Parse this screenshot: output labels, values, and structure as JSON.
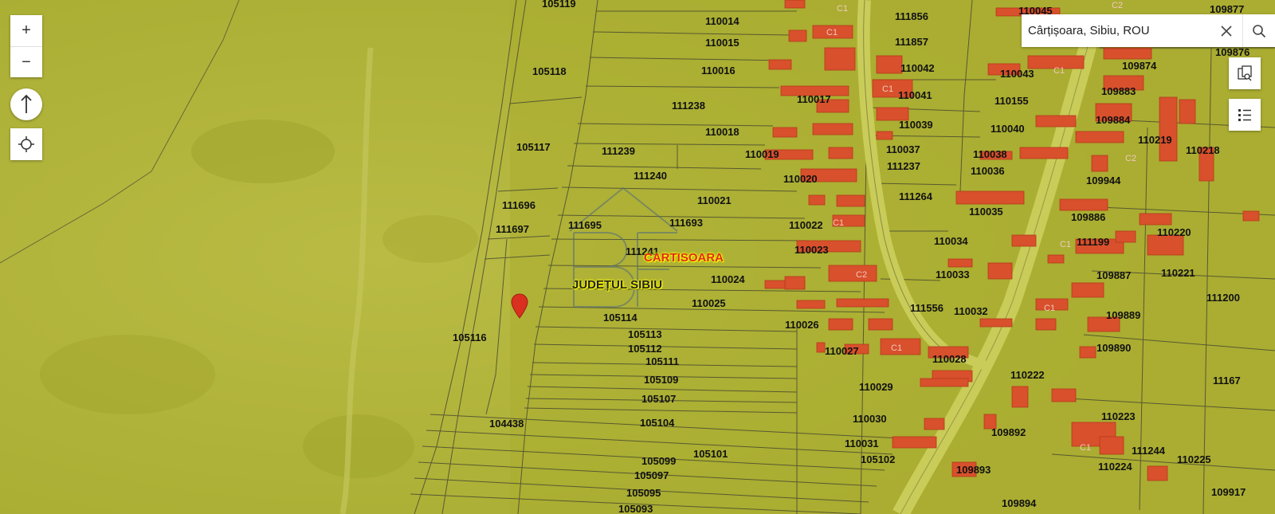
{
  "search": {
    "value": "Cârțișoara, Sibiu, ROU",
    "placeholder": ""
  },
  "controls": {
    "zoom_in": "+",
    "zoom_out": "−",
    "north_arrow_icon": "arrow-up-icon",
    "locate_icon": "crosshair-icon",
    "clear_icon": "close-icon",
    "search_icon": "search-icon",
    "compare_icon": "document-compare-icon",
    "layers_list_icon": "list-icon"
  },
  "place_labels": {
    "locality": "CARTISOARA",
    "county": "JUDEȚUL SIBIU"
  },
  "marker": {
    "icon": "map-pin-icon",
    "color": "#d9301f"
  },
  "colors": {
    "map_base": "#b5b83a",
    "building": "#d8502c",
    "road": "#c9cc58",
    "parcel_line": "#4a4a30"
  },
  "parcels": [
    "105119",
    "110014",
    "110015",
    "110016",
    "105118",
    "111238",
    "110017",
    "110018",
    "105117",
    "111239",
    "110019",
    "111240",
    "110020",
    "110021",
    "111696",
    "111695",
    "111693",
    "111697",
    "110022",
    "111241",
    "110023",
    "110024",
    "110025",
    "105114",
    "105113",
    "105112",
    "105111",
    "105109",
    "105107",
    "105104",
    "104438",
    "105116",
    "105101",
    "105099",
    "105097",
    "105095",
    "105093",
    "110026",
    "110027",
    "110028",
    "110029",
    "110030",
    "110031",
    "105102",
    "111856",
    "111857",
    "110042",
    "110041",
    "110039",
    "110037",
    "111237",
    "111264",
    "110034",
    "110033",
    "111556",
    "110032",
    "110045",
    "110043",
    "110155",
    "110040",
    "110038",
    "110036",
    "110035",
    "111199",
    "109874",
    "109883",
    "109884",
    "109944",
    "109886",
    "109887",
    "109889",
    "109890",
    "110219",
    "110218",
    "110220",
    "110221",
    "111200",
    "110222",
    "110223",
    "110224",
    "109892",
    "109893",
    "109894",
    "111244",
    "110225",
    "109877",
    "109876",
    "109917",
    "11167"
  ],
  "building_labels": [
    "C1",
    "C1",
    "C1",
    "C1",
    "C1",
    "C2",
    "C1",
    "C1",
    "C1",
    "C2",
    "C1",
    "C1"
  ]
}
